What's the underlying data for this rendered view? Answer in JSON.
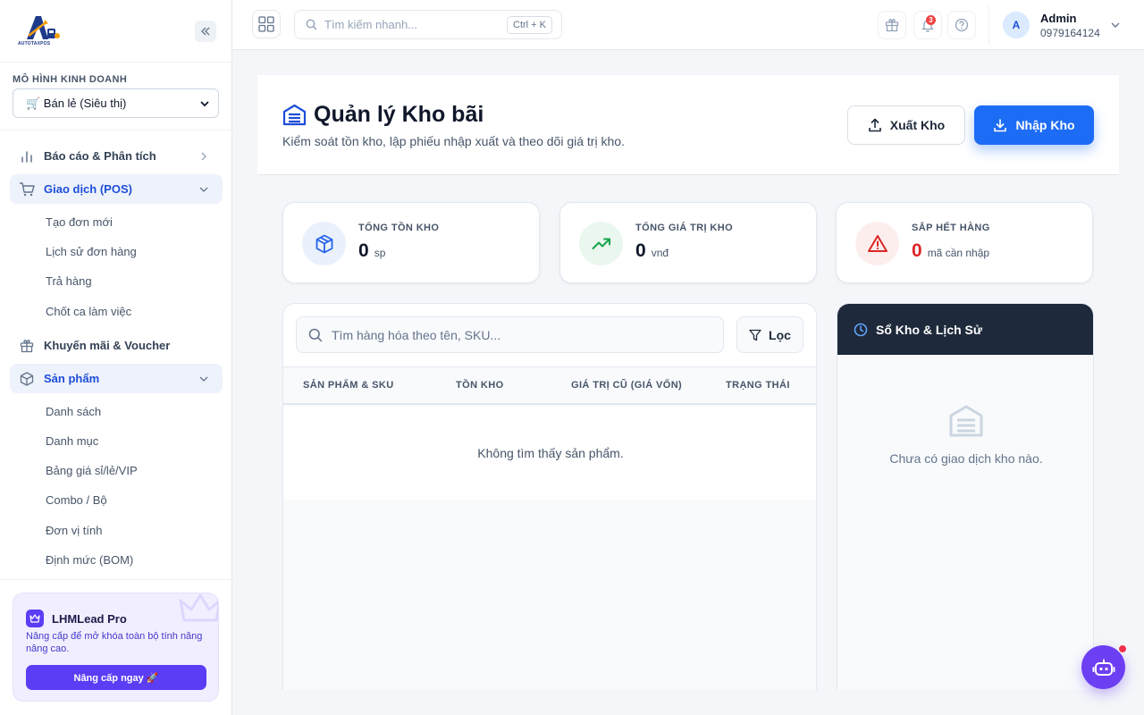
{
  "colors": {
    "primary": "#1d6cf5",
    "accent": "#1d4ed8",
    "danger": "#dc2626",
    "success": "#16a34a",
    "dark_panel": "#1e293b",
    "pro": "#5b3df5"
  },
  "sidebar": {
    "logo_text": "AUTOTAXPOS",
    "business_model_label": "MÔ HÌNH KINH DOANH",
    "business_model_value": "🛒 Bán lẻ (Siêu thị)",
    "items": [
      {
        "label": "Báo cáo & Phân tích",
        "icon": "bar-chart-icon"
      },
      {
        "label": "Giao dịch (POS)",
        "icon": "cart-icon"
      },
      {
        "label": "Khuyến mãi & Voucher",
        "icon": "gift-icon"
      },
      {
        "label": "Sản phẩm",
        "icon": "box-icon"
      }
    ],
    "pos_sub": [
      "Tạo đơn mới",
      "Lịch sử đơn hàng",
      "Trả hàng",
      "Chốt ca làm việc"
    ],
    "product_sub": [
      "Danh sách",
      "Danh mục",
      "Bảng giá sỉ/lẻ/VIP",
      "Combo / Bộ",
      "Đơn vị tính",
      "Định mức (BOM)"
    ],
    "pro": {
      "title": "LHMLead Pro",
      "desc": "Nâng cấp để mở khóa toàn bộ tính năng nâng cao.",
      "button": "Nâng cấp ngay 🚀"
    }
  },
  "topbar": {
    "search_placeholder": "Tìm kiếm nhanh...",
    "shortcut": "Ctrl + K",
    "notif_count": "3",
    "user_initial": "A",
    "user_name": "Admin",
    "user_phone": "0979164124"
  },
  "page": {
    "title": "Quản lý Kho bãi",
    "subtitle": "Kiểm soát tồn kho, lập phiếu nhập xuất và theo dõi giá trị kho.",
    "export_label": "Xuất Kho",
    "import_label": "Nhập Kho"
  },
  "stats": [
    {
      "label": "TỔNG TỒN KHO",
      "value": "0",
      "unit": "sp",
      "icon": "package-icon"
    },
    {
      "label": "TỔNG GIÁ TRỊ KHO",
      "value": "0",
      "unit": "vnđ",
      "icon": "trending-up-icon"
    },
    {
      "label": "SẮP HẾT HÀNG",
      "value": "0",
      "unit": "mã cần nhập",
      "icon": "alert-triangle-icon"
    }
  ],
  "table": {
    "search_placeholder": "Tìm hàng hóa theo tên, SKU...",
    "filter_label": "Lọc",
    "columns": [
      "SẢN PHẨM & SKU",
      "TỒN KHO",
      "GIÁ TRỊ CŨ (GIÁ VỐN)",
      "TRẠNG THÁI"
    ],
    "empty": "Không tìm thấy sản phẩm."
  },
  "history": {
    "title": "Sổ Kho & Lịch Sử",
    "empty": "Chưa có giao dịch kho nào."
  }
}
